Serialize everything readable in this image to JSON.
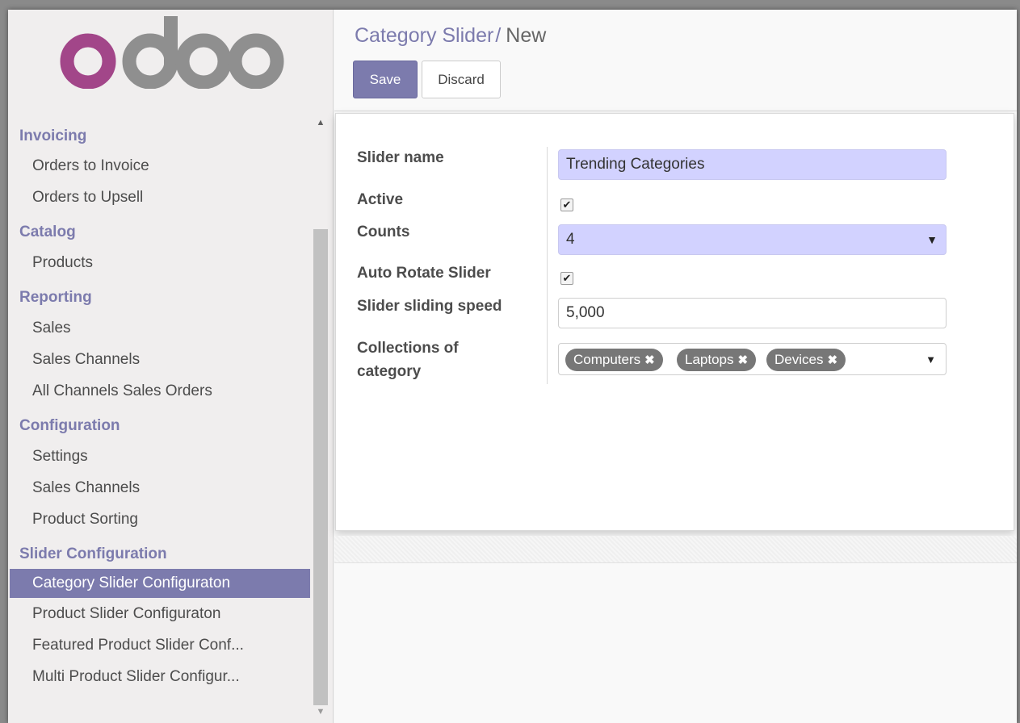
{
  "logo": {
    "text": "odoo",
    "colors": {
      "o1": "#a24689",
      "rest": "#8f8f8f"
    }
  },
  "sidebar": {
    "sections": [
      {
        "title": "Invoicing",
        "items": [
          {
            "label": "Orders to Invoice"
          },
          {
            "label": "Orders to Upsell"
          }
        ]
      },
      {
        "title": "Catalog",
        "items": [
          {
            "label": "Products"
          }
        ]
      },
      {
        "title": "Reporting",
        "items": [
          {
            "label": "Sales"
          },
          {
            "label": "Sales Channels"
          },
          {
            "label": "All Channels Sales Orders"
          }
        ]
      },
      {
        "title": "Configuration",
        "items": [
          {
            "label": "Settings"
          },
          {
            "label": "Sales Channels"
          },
          {
            "label": "Product Sorting"
          }
        ]
      },
      {
        "title": "Slider Configuration",
        "items": [
          {
            "label": "Category Slider Configuraton",
            "active": true
          },
          {
            "label": "Product Slider Configuraton"
          },
          {
            "label": "Featured Product Slider Conf..."
          },
          {
            "label": "Multi Product Slider Configur..."
          }
        ]
      }
    ]
  },
  "breadcrumb": {
    "parent": "Category Slider",
    "separator": "/",
    "current": "New"
  },
  "buttons": {
    "save": "Save",
    "discard": "Discard"
  },
  "form": {
    "slider_name": {
      "label": "Slider name",
      "value": "Trending Categories"
    },
    "active": {
      "label": "Active",
      "checked": true
    },
    "counts": {
      "label": "Counts",
      "value": "4"
    },
    "auto_rotate": {
      "label": "Auto Rotate Slider",
      "checked": true
    },
    "speed": {
      "label": "Slider sliding speed",
      "value": "5,000"
    },
    "collections": {
      "label_line1": "Collections of",
      "label_line2": "category",
      "tags": [
        "Computers",
        "Laptops",
        "Devices"
      ]
    }
  },
  "colors": {
    "accent": "#7c7bad",
    "required_field": "#d2d2ff",
    "tag": "#777777"
  }
}
